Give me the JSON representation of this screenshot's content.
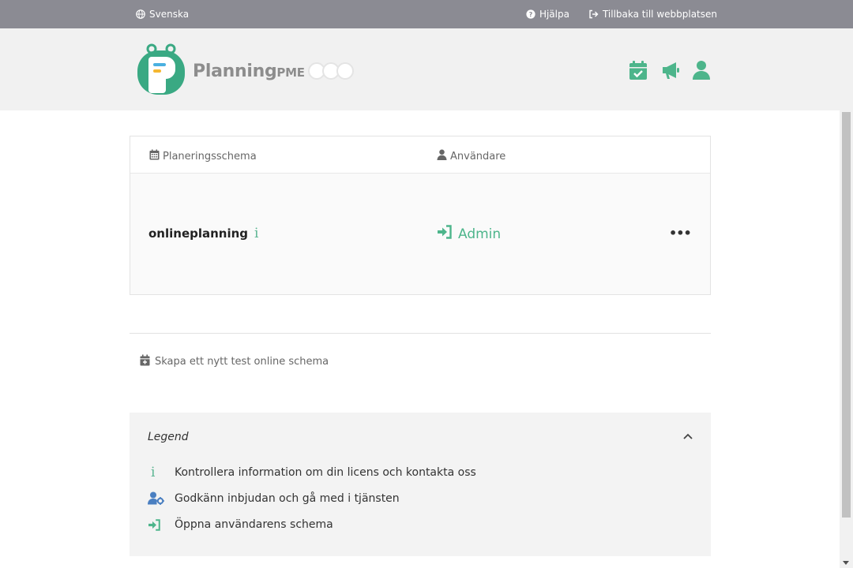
{
  "topbar": {
    "language": "Svenska",
    "help": "Hjälpa",
    "back_to_site": "Tillbaka till webbplatsen"
  },
  "header": {
    "logo_main": "Planning",
    "logo_suffix": "PME"
  },
  "table": {
    "columns": {
      "schema": "Planeringsschema",
      "user": "Användare"
    },
    "rows": [
      {
        "schema": "onlineplanning",
        "info": "i",
        "user": "Admin",
        "more": "•••"
      }
    ]
  },
  "create_link": "Skapa ett nytt test online schema",
  "legend": {
    "title": "Legend",
    "items": [
      {
        "icon": "info-icon",
        "symbol": "i",
        "text": "Kontrollera information om din licens och kontakta oss"
      },
      {
        "icon": "user-gear-icon",
        "text": "Godkänn inbjudan och gå med i tjänsten"
      },
      {
        "icon": "sign-in-icon",
        "text": "Öppna användarens schema"
      }
    ]
  },
  "colors": {
    "accent": "#4db58b",
    "topbar": "#8b8b93",
    "header_bg": "#f1f1f1",
    "legend_blue": "#4a7fc1"
  }
}
